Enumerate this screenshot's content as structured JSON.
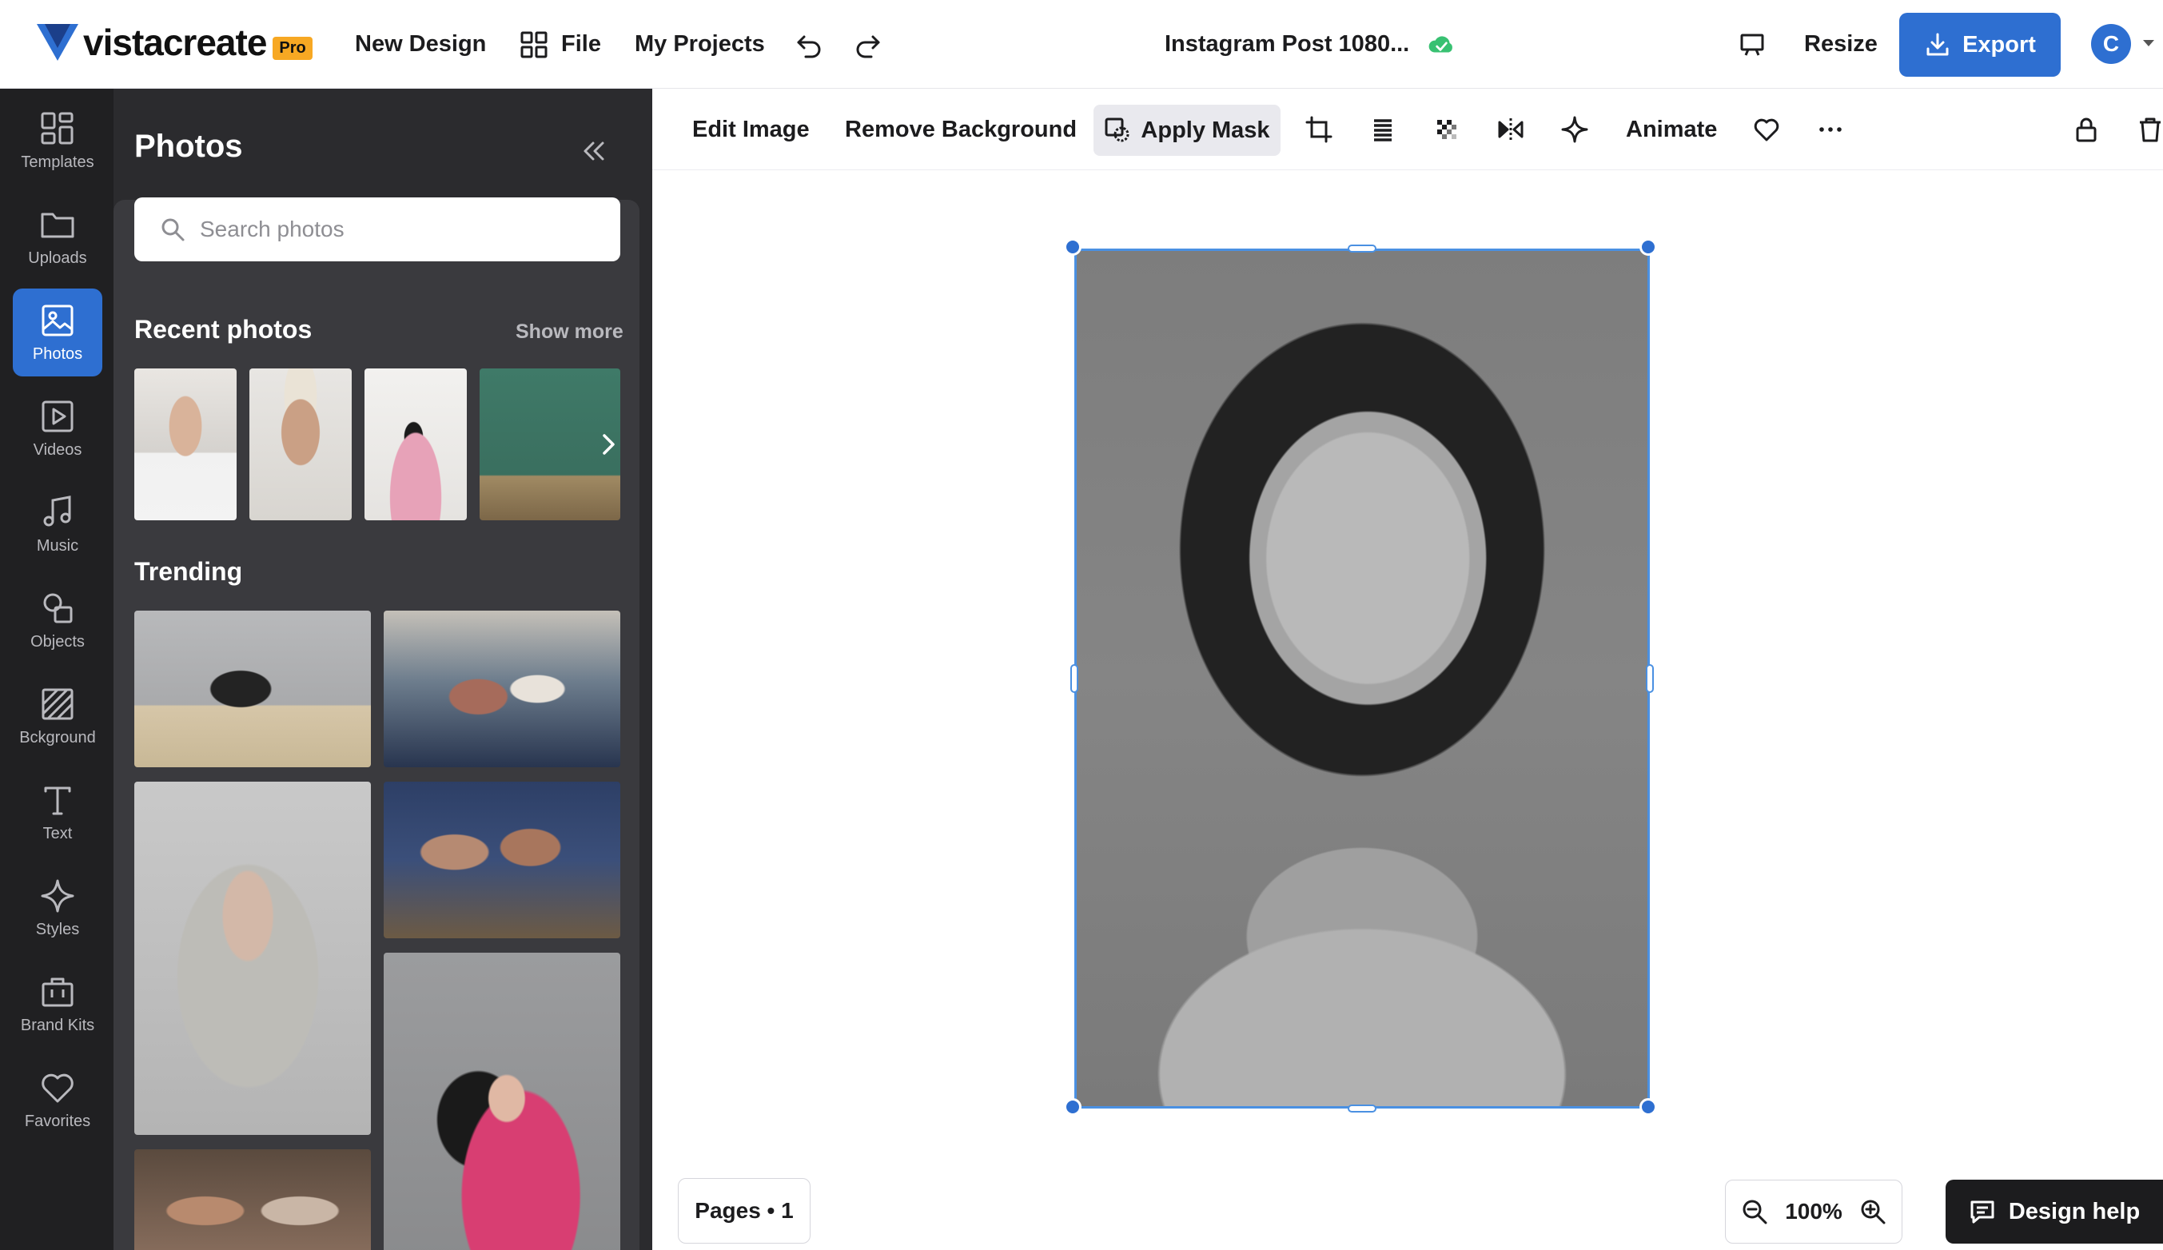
{
  "brand": {
    "name": "vistacreate",
    "badge": "Pro",
    "accent": "#2e6fd1"
  },
  "header": {
    "new_design": "New Design",
    "file": "File",
    "my_projects": "My Projects",
    "title": "Instagram Post 1080...",
    "resize": "Resize",
    "export": "Export",
    "avatar_initial": "C"
  },
  "rail": [
    {
      "label": "Templates",
      "icon": "templates-icon"
    },
    {
      "label": "Uploads",
      "icon": "folder-icon"
    },
    {
      "label": "Photos",
      "icon": "image-icon",
      "active": true
    },
    {
      "label": "Videos",
      "icon": "video-icon"
    },
    {
      "label": "Music",
      "icon": "music-icon"
    },
    {
      "label": "Objects",
      "icon": "shapes-icon"
    },
    {
      "label": "Bckground",
      "icon": "background-icon"
    },
    {
      "label": "Text",
      "icon": "text-icon"
    },
    {
      "label": "Styles",
      "icon": "sparkle-icon"
    },
    {
      "label": "Brand Kits",
      "icon": "briefcase-icon"
    },
    {
      "label": "Favorites",
      "icon": "heart-icon"
    }
  ],
  "panel": {
    "title": "Photos",
    "search_placeholder": "Search photos",
    "recent_title": "Recent photos",
    "show_more": "Show more",
    "trending_title": "Trending"
  },
  "toolbar": {
    "edit_image": "Edit Image",
    "remove_background": "Remove Background",
    "apply_mask": "Apply Mask",
    "animate": "Animate"
  },
  "footer": {
    "pages": "Pages • 1",
    "zoom": "100%",
    "design_help": "Design help"
  }
}
